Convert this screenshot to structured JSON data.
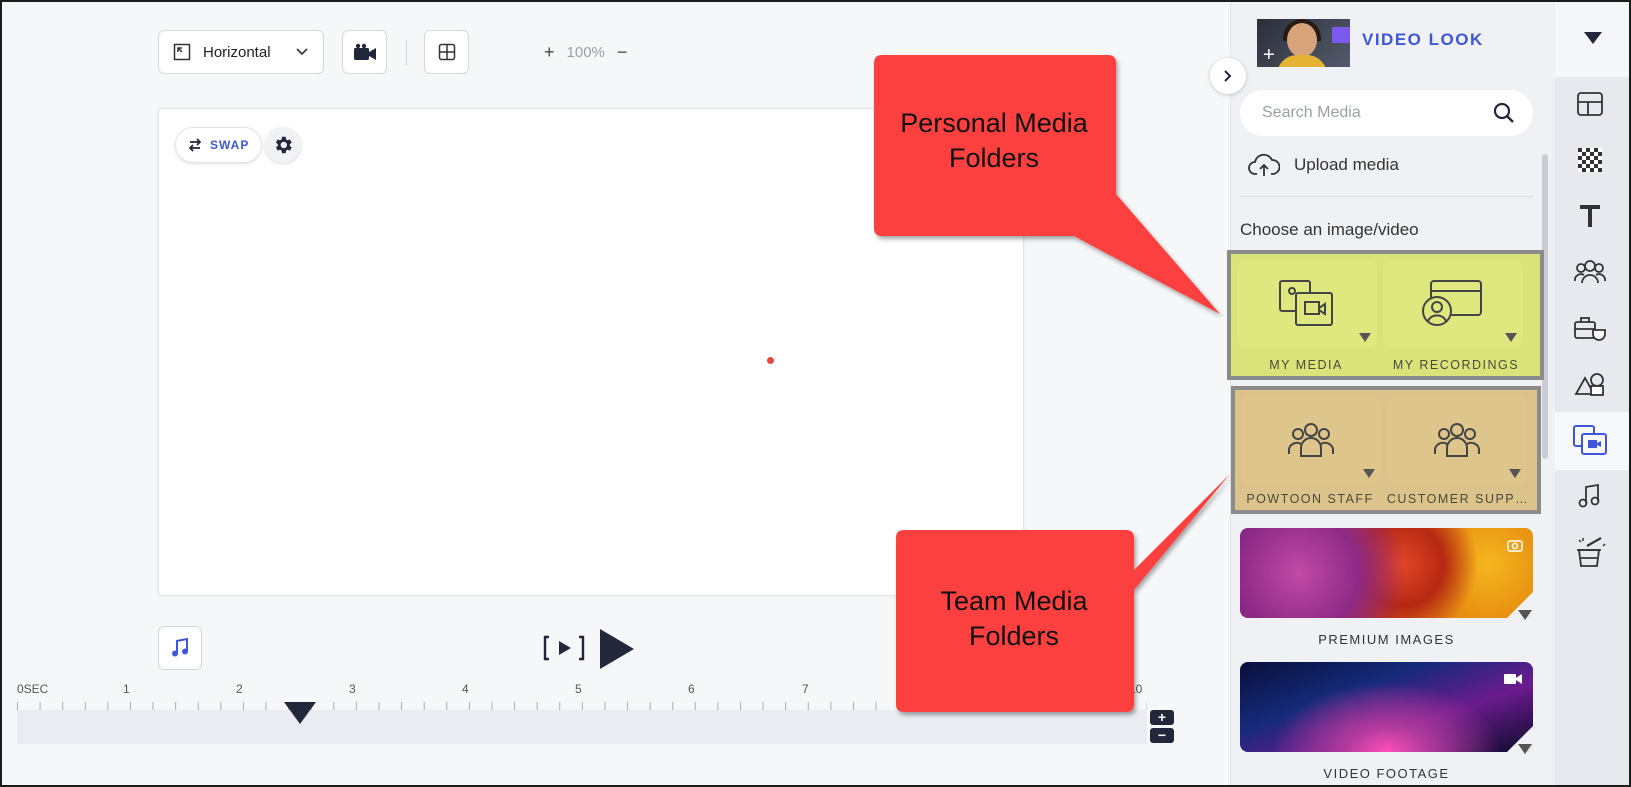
{
  "toolbar": {
    "orientation_label": "Horizontal",
    "zoom_level": "100%"
  },
  "canvas": {
    "swap_label": "SWAP"
  },
  "timeline": {
    "ticks": [
      "0SEC",
      "1",
      "2",
      "3",
      "4",
      "5",
      "6",
      "7",
      "10"
    ]
  },
  "panel": {
    "look_title": "VIDEO LOOK",
    "search_placeholder": "Search Media",
    "upload_label": "Upload media",
    "choose_label": "Choose an image/video",
    "personal_folders": [
      {
        "label": "MY MEDIA",
        "icon": "media-stack-icon"
      },
      {
        "label": "MY RECORDINGS",
        "icon": "recording-profile-icon"
      }
    ],
    "team_folders": [
      {
        "label": "POWTOON STAFF",
        "icon": "team-icon"
      },
      {
        "label": "CUSTOMER SUPP…",
        "icon": "team-icon"
      }
    ],
    "premium_label": "PREMIUM IMAGES",
    "video_label": "VIDEO FOOTAGE"
  },
  "callouts": {
    "personal": "Personal Media Folders",
    "team": "Team Media Folders"
  },
  "colors": {
    "accent": "#3d57d8",
    "dark": "#22273a",
    "callout": "#fc4040",
    "personal_folder_bg": "#d9e37a",
    "team_folder_bg": "#dcc38b"
  }
}
